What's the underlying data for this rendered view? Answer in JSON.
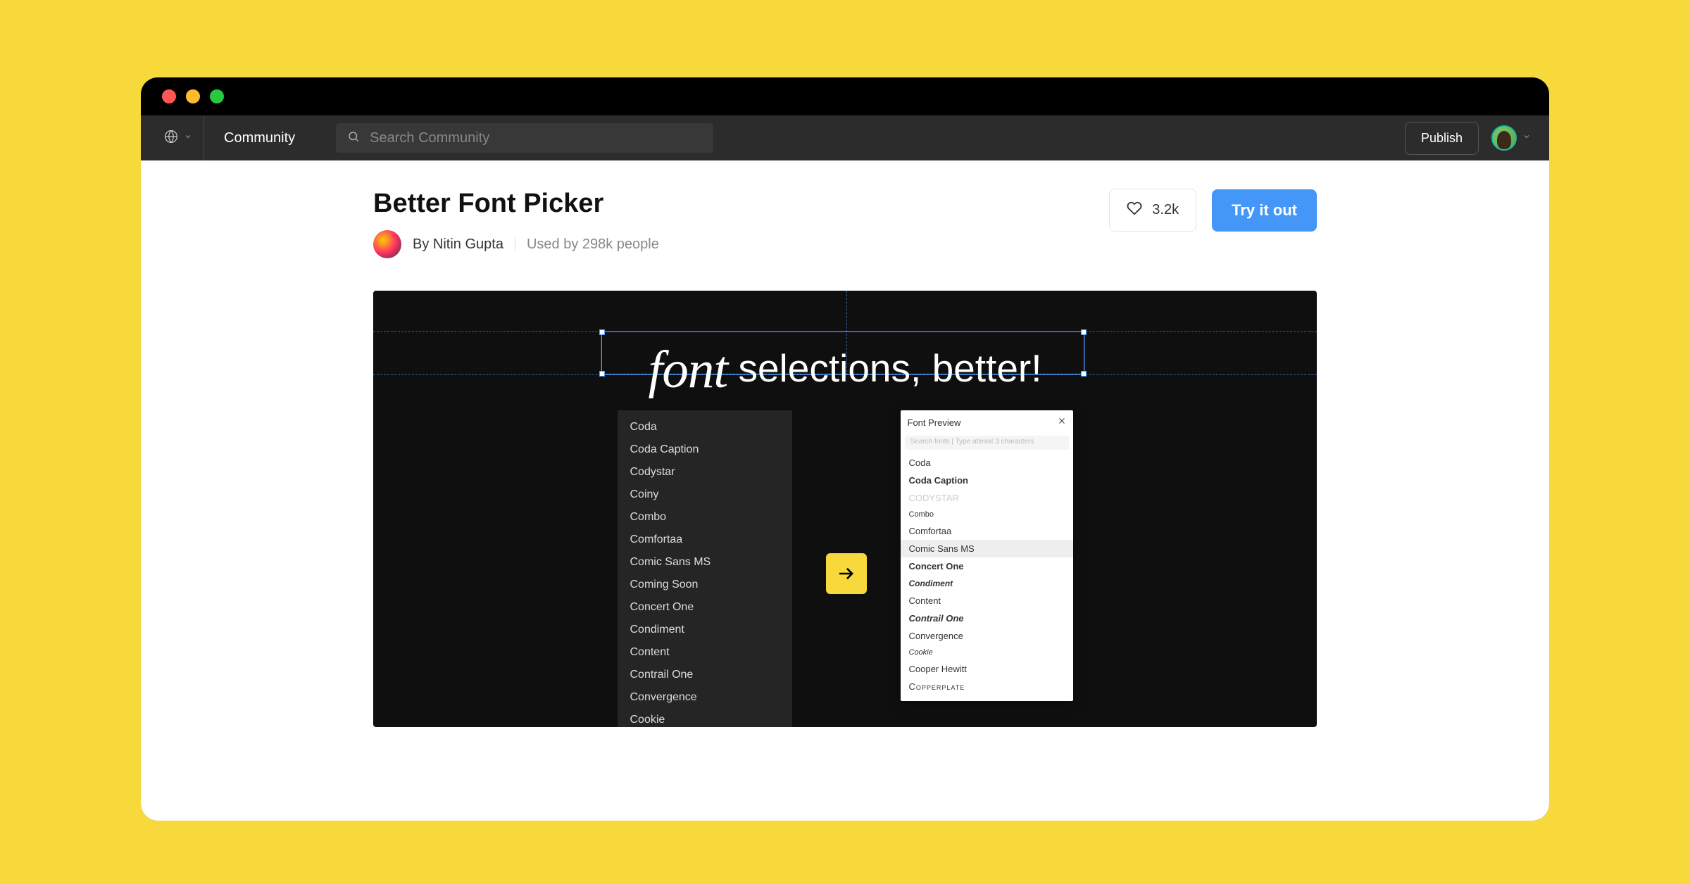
{
  "topbar": {
    "community_label": "Community",
    "search_placeholder": "Search Community",
    "publish_label": "Publish"
  },
  "plugin": {
    "title": "Better Font Picker",
    "byline": "By Nitin Gupta",
    "used_by": "Used by 298k people",
    "like_count": "3.2k",
    "try_label": "Try it out"
  },
  "hero": {
    "headline_cursive": "font",
    "headline_rest": " selections, better!",
    "left_fonts": [
      "Coda",
      "Coda Caption",
      "Codystar",
      "Coiny",
      "Combo",
      "Comfortaa",
      "Comic Sans MS",
      "Coming Soon",
      "Concert One",
      "Condiment",
      "Content",
      "Contrail One",
      "Convergence",
      "Cookie"
    ],
    "preview": {
      "title": "Font Preview",
      "search_placeholder": "Search fonts | Type atleast 3 characters",
      "items": [
        {
          "name": "Coda",
          "cls": ""
        },
        {
          "name": "Coda Caption",
          "cls": "bold"
        },
        {
          "name": "CODYSTAR",
          "cls": "light"
        },
        {
          "name": "Combo",
          "cls": "tiny"
        },
        {
          "name": "Comfortaa",
          "cls": ""
        },
        {
          "name": "Comic Sans MS",
          "cls": "hover"
        },
        {
          "name": "Concert One",
          "cls": "bold"
        },
        {
          "name": "Condiment",
          "cls": "condensed"
        },
        {
          "name": "Content",
          "cls": ""
        },
        {
          "name": "Contrail One",
          "cls": "bold italic"
        },
        {
          "name": "Convergence",
          "cls": ""
        },
        {
          "name": "Cookie",
          "cls": "tiny italic"
        },
        {
          "name": "Cooper Hewitt",
          "cls": ""
        },
        {
          "name": "Copperplate",
          "cls": "smallcaps"
        }
      ]
    }
  }
}
